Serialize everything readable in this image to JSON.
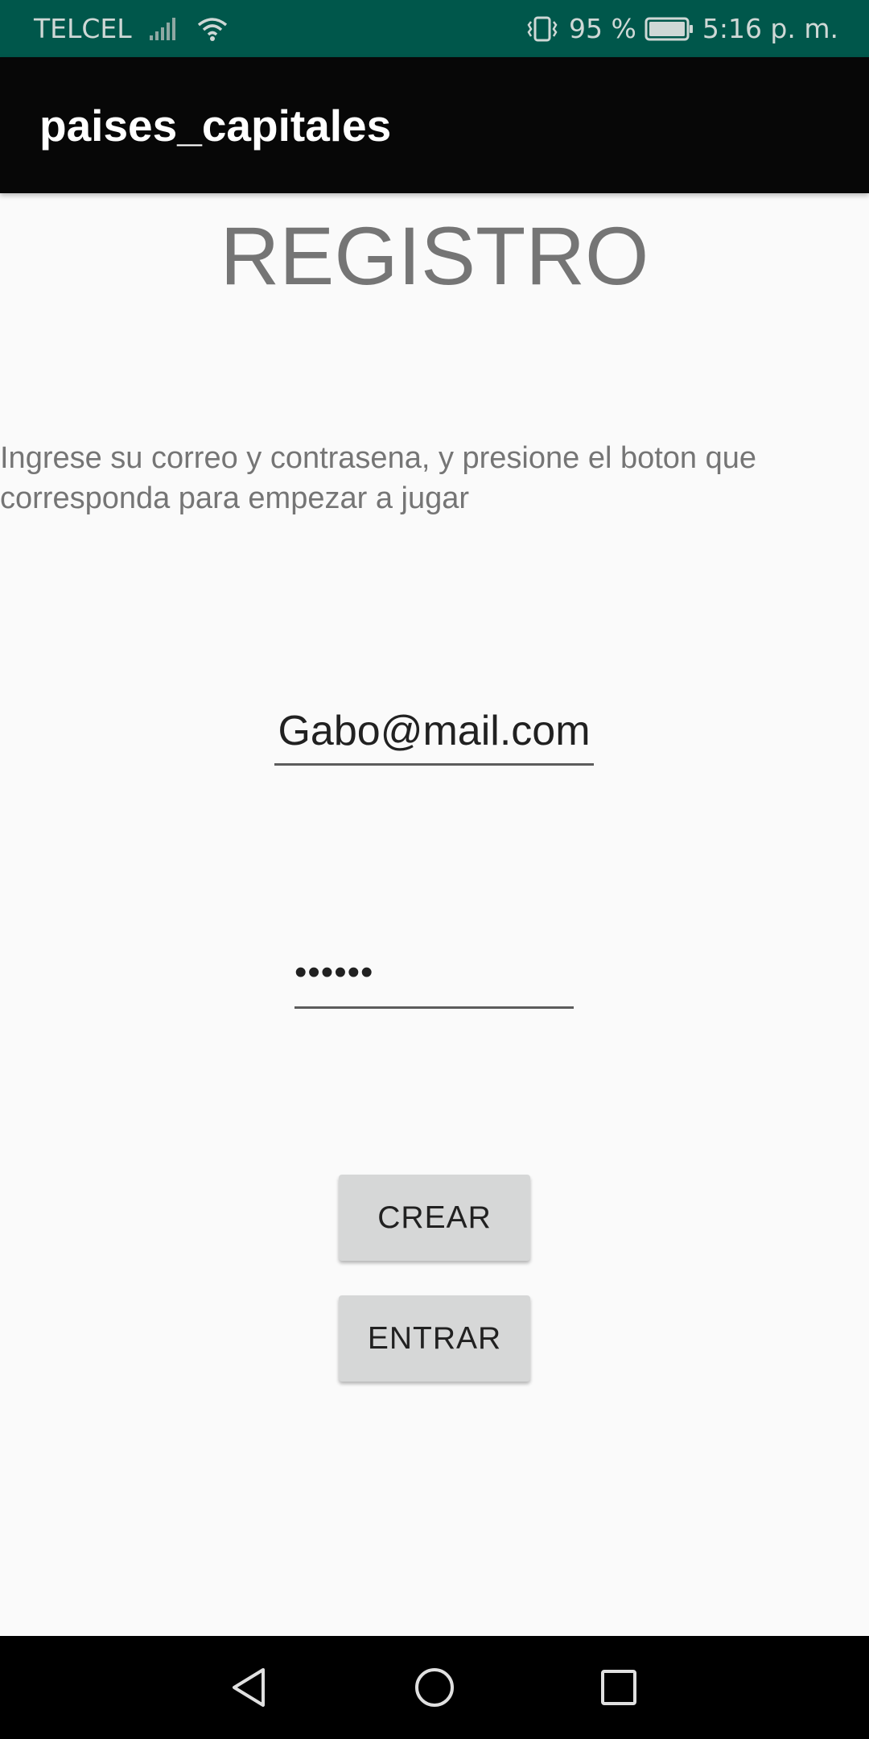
{
  "status_bar": {
    "carrier": "TELCEL",
    "battery": "95 %",
    "time": "5:16 p. m.",
    "icons": [
      "signal-icon",
      "wifi-icon",
      "vibrate-icon",
      "battery-icon"
    ]
  },
  "app_bar": {
    "title": "paises_capitales"
  },
  "main": {
    "heading": "REGISTRO",
    "instructions": "Ingrese su correo y contrasena, y presione el boton que corresponda para empezar a jugar",
    "email_value": "Gabo@mail.com",
    "password_mask": "••••••",
    "create_button": "CREAR",
    "enter_button": "ENTRAR"
  },
  "nav_bar": {
    "icons": [
      "back-icon",
      "home-icon",
      "recents-icon"
    ]
  },
  "colors": {
    "status_bar": "#00574b",
    "app_bar": "#070707",
    "background": "#fafafa",
    "button": "#d6d7d7",
    "text_gray": "#757575"
  }
}
